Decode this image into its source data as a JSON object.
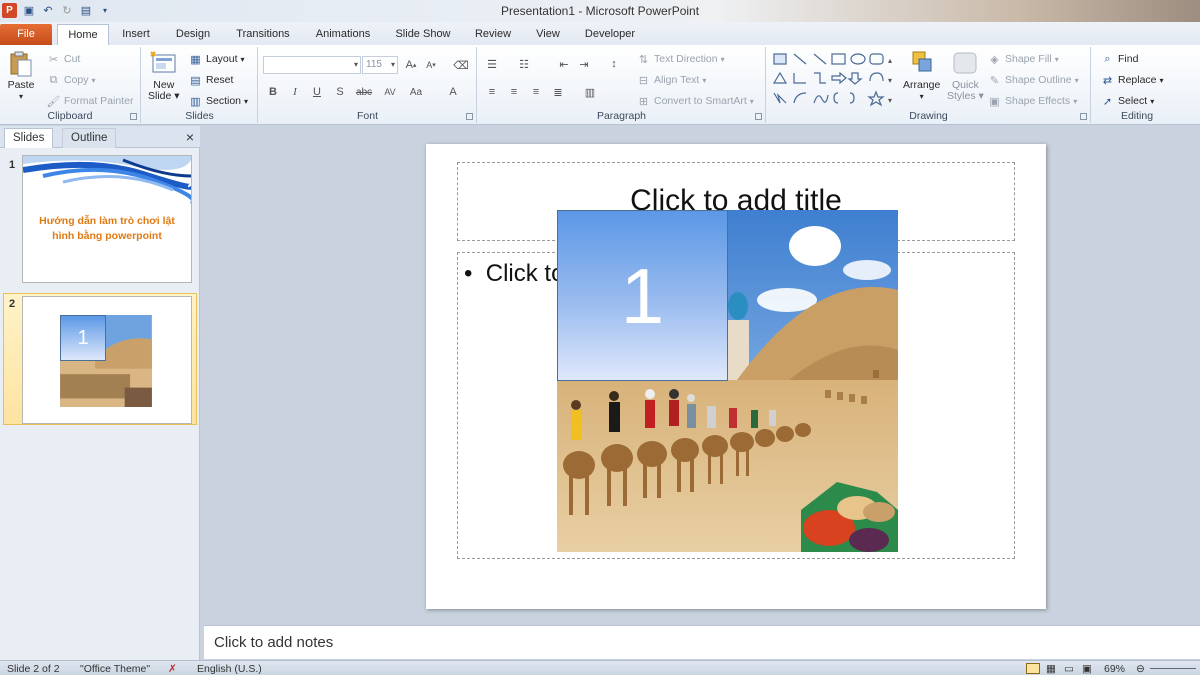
{
  "window": {
    "title": "Presentation1  -  Microsoft PowerPoint"
  },
  "qat": {
    "logo": "P"
  },
  "tabs": [
    "File",
    "Home",
    "Insert",
    "Design",
    "Transitions",
    "Animations",
    "Slide Show",
    "Review",
    "View",
    "Developer"
  ],
  "ribbon": {
    "clipboard": {
      "label": "Clipboard",
      "paste": "Paste",
      "cut": "Cut",
      "copy": "Copy",
      "format_painter": "Format Painter"
    },
    "slides": {
      "label": "Slides",
      "new_slide_1": "New",
      "new_slide_2": "Slide",
      "layout": "Layout",
      "reset": "Reset",
      "section": "Section"
    },
    "font": {
      "label": "Font",
      "font_name": "",
      "font_size": "115",
      "bold": "B",
      "italic": "I",
      "underline": "U",
      "shadow": "S",
      "strike": "abc",
      "spacing": "AV",
      "case": "Aa",
      "color": "A"
    },
    "paragraph": {
      "label": "Paragraph",
      "text_direction": "Text Direction",
      "align_text": "Align Text",
      "convert_smartart": "Convert to SmartArt"
    },
    "drawing": {
      "label": "Drawing",
      "arrange": "Arrange",
      "quick_styles_1": "Quick",
      "quick_styles_2": "Styles",
      "shape_fill": "Shape Fill",
      "shape_outline": "Shape Outline",
      "shape_effects": "Shape Effects"
    },
    "editing": {
      "label": "Editing",
      "find": "Find",
      "replace": "Replace",
      "select": "Select"
    }
  },
  "pane": {
    "tab_slides": "Slides",
    "tab_outline": "Outline",
    "close": "×",
    "thumbs": [
      {
        "num": "1",
        "title": "Hướng dẫn làm trò chơi lật hình bằng powerpoint"
      },
      {
        "num": "2",
        "number_label": "1"
      }
    ]
  },
  "slide": {
    "title_placeholder": "Click to add title",
    "content_placeholder": "Click to add text",
    "number_box": "1"
  },
  "notes": {
    "placeholder": "Click to add notes"
  },
  "status": {
    "slide_info": "Slide 2 of 2",
    "theme": "\"Office Theme\"",
    "language": "English (U.S.)",
    "zoom": "69%"
  },
  "colors": {
    "file_tab": "#d9582a",
    "accent": "#2f5b94",
    "selection": "#fde3a0"
  }
}
